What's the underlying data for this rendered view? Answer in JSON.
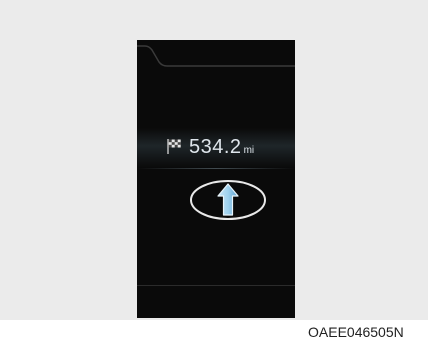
{
  "cluster": {
    "distance_value": "534.2",
    "distance_unit": "mi",
    "destination_icon": "checkered-flag-icon",
    "direction_icon": "straight-ahead-arrow-icon"
  },
  "caption": {
    "code": "OAEE046505N"
  },
  "colors": {
    "screen": "#0a0a0a",
    "text": "#dfe6ec",
    "arrow": "#8fc8ea",
    "background": "#ebebeb"
  }
}
